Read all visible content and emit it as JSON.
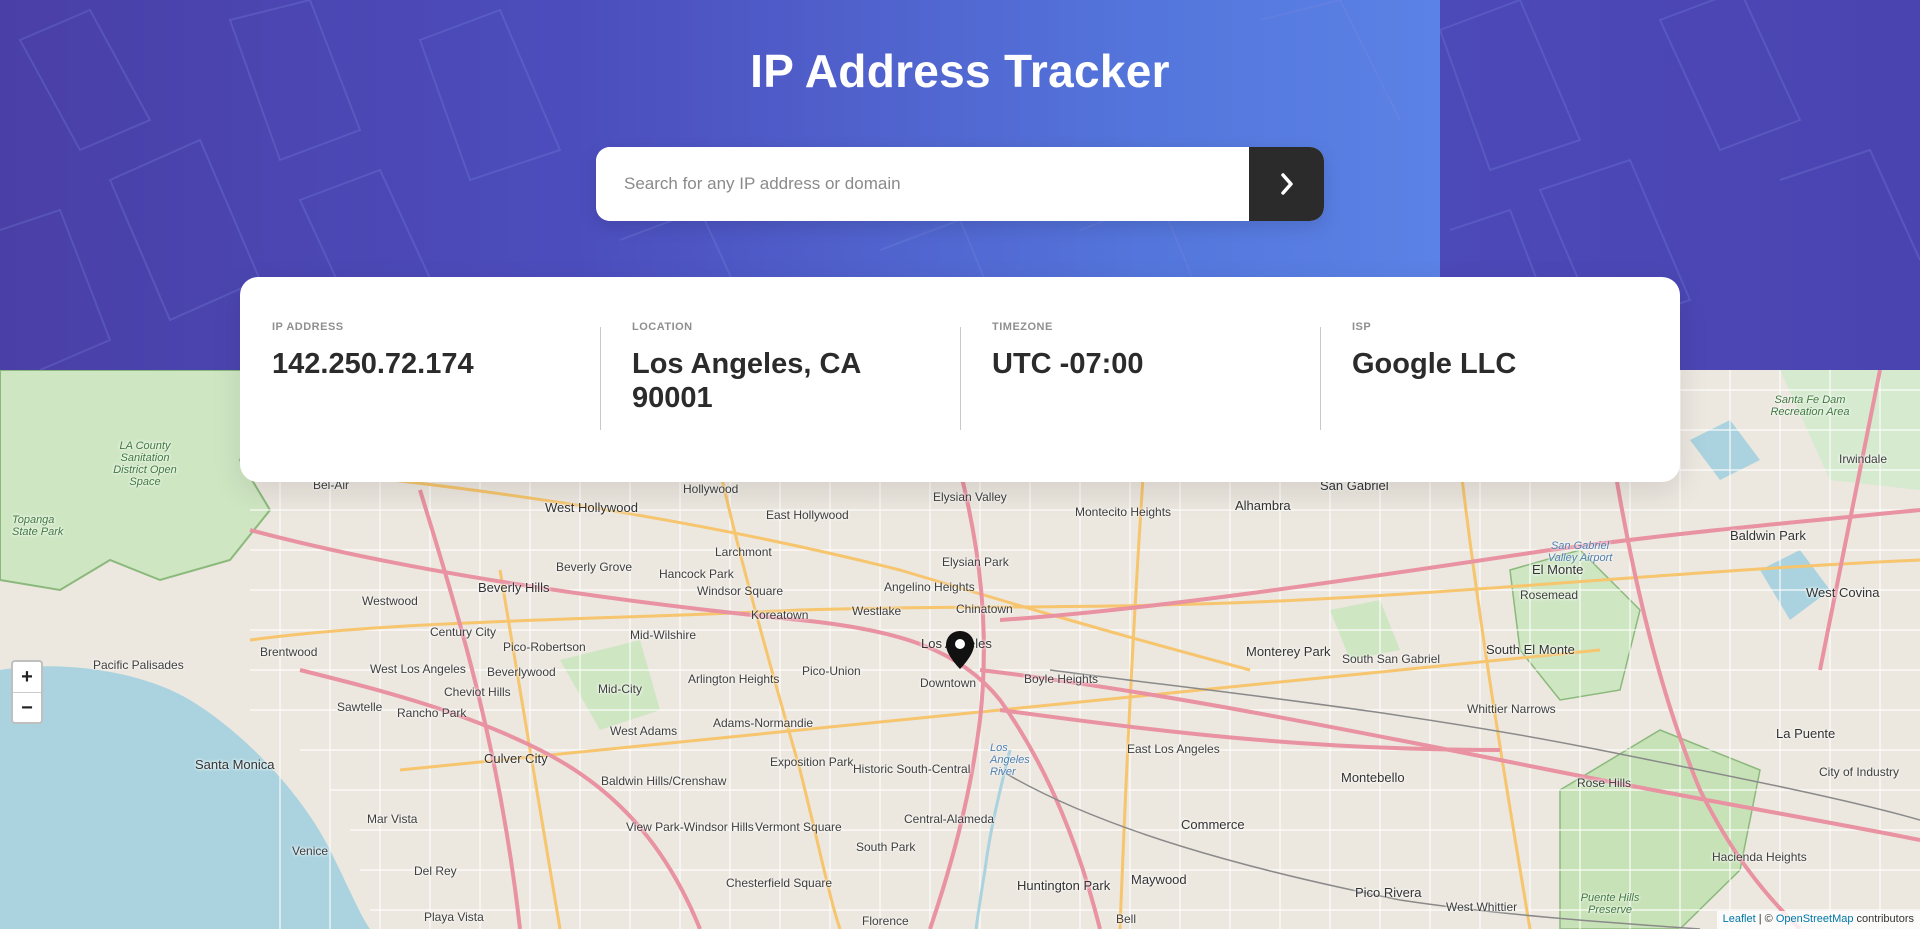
{
  "header": {
    "title": "IP Address Tracker",
    "search_placeholder": "Search for any IP address or domain",
    "search_value": "",
    "submit_icon": "chevron-right-icon"
  },
  "info": [
    {
      "label": "IP Address",
      "value": "142.250.72.174"
    },
    {
      "label": "Location",
      "value": "Los Angeles, CA 90001"
    },
    {
      "label": "Timezone",
      "value": "UTC -07:00"
    },
    {
      "label": "ISP",
      "value": "Google LLC"
    }
  ],
  "map": {
    "zoom_in": "+",
    "zoom_out": "−",
    "marker_icon": "location-pin-icon",
    "attribution": {
      "leaflet": "Leaflet",
      "separator": " | © ",
      "osm": "OpenStreetMap",
      "suffix": " contributors"
    },
    "places": [
      "Bel-Air",
      "West Hollywood",
      "Hollywood",
      "East Hollywood",
      "Elysian Valley",
      "Montecito Heights",
      "Alhambra",
      "San Gabriel",
      "Baldwin Park",
      "El Monte",
      "West Covina",
      "Rosemead",
      "Irwindale",
      "Beverly Grove",
      "Hancock Park",
      "Larchmont",
      "Elysian Park",
      "Angelino Heights",
      "Chinatown",
      "Beverly Hills",
      "Windsor Square",
      "Koreatown",
      "Westlake",
      "Los Angeles",
      "Downtown",
      "Boyle Heights",
      "Westwood",
      "Century City",
      "Pico-Robertson",
      "Mid-Wilshire",
      "Brentwood",
      "West Los Angeles",
      "Beverlywood",
      "Arlington Heights",
      "Pico-Union",
      "Monterey Park",
      "South San Gabriel",
      "South El Monte",
      "Pacific Palisades",
      "Cheviot Hills",
      "Mid-City",
      "Sawtelle",
      "Rancho Park",
      "Whittier Narrows",
      "La Puente",
      "Adams-Normandie",
      "West Adams",
      "Santa Monica",
      "Culver City",
      "Exposition Park",
      "Historic South-Central",
      "East Los Angeles",
      "Montebello",
      "City of Industry",
      "Baldwin Hills/Crenshaw",
      "Rose Hills",
      "Mar Vista",
      "View Park-Windsor Hills",
      "Vermont Square",
      "Central-Alameda",
      "Commerce",
      "South Park",
      "Venice",
      "Hacienda Heights",
      "Del Rey",
      "Chesterfield Square",
      "Huntington Park",
      "Maywood",
      "Pico Rivera",
      "West Whittier",
      "Playa Vista",
      "Florence",
      "Bell"
    ],
    "parks": [
      "Topanga State Park",
      "LA County Sanitation District Open Space",
      "Santa Fe Dam Recreation Area",
      "San Gabriel Valley Airport",
      "Los Angeles River",
      "Puente Hills Preserve"
    ]
  }
}
